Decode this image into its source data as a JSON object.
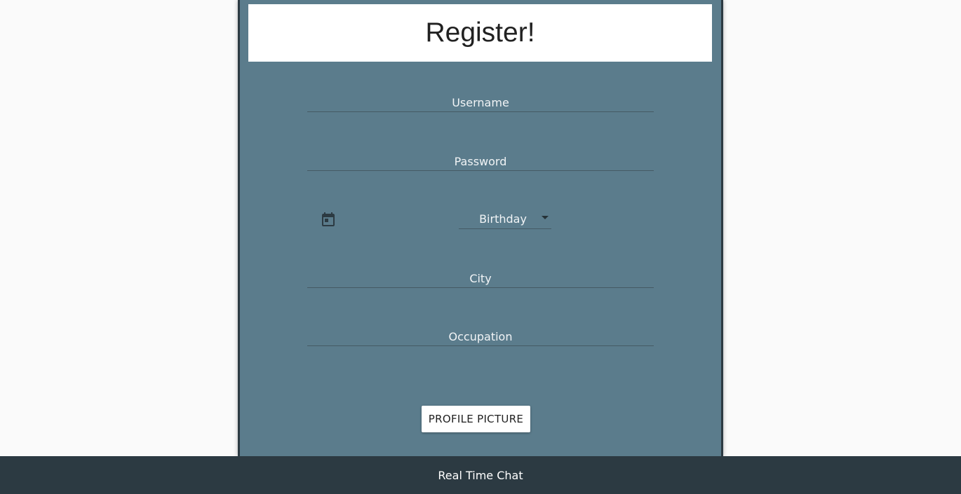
{
  "form": {
    "title": "Register!",
    "fields": {
      "username": {
        "placeholder": "Username",
        "value": ""
      },
      "password": {
        "placeholder": "Password",
        "value": ""
      },
      "city": {
        "placeholder": "City",
        "value": ""
      },
      "occupation": {
        "placeholder": "Occupation",
        "value": ""
      }
    },
    "birthday": {
      "label": "Birthday",
      "icon": "calendar-icon",
      "caret_icon": "caret-down-icon"
    },
    "profile_picture_button": "PROFILE PICTURE"
  },
  "footer": {
    "text": "Real Time Chat"
  },
  "colors": {
    "panel": "#5b7c8c",
    "panel_border": "#2c3a42",
    "footer": "#2c3a42",
    "page_background": "#fafafa"
  }
}
